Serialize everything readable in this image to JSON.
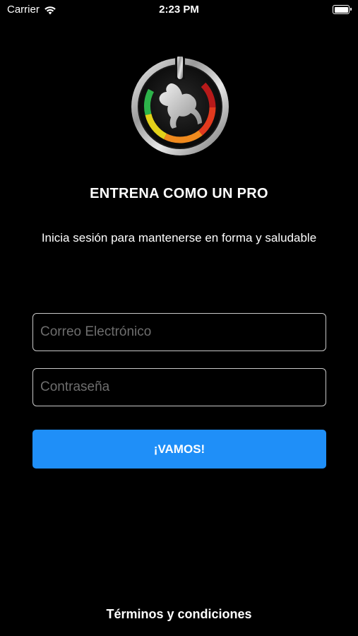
{
  "status_bar": {
    "carrier": "Carrier",
    "time": "2:23 PM",
    "icons": [
      "wifi-icon",
      "battery-icon"
    ]
  },
  "logo": {
    "icon": "power-button-bodybuilder-logo",
    "ring_colors": [
      "#2db34a",
      "#e4d21a",
      "#f08a1e",
      "#e23a1e",
      "#b81a1a"
    ]
  },
  "headline": "ENTRENA COMO UN PRO",
  "subtitle": "Inicia sesión para mantenerse en forma y saludable",
  "form": {
    "email_placeholder": "Correo Electrónico",
    "email_value": "",
    "password_placeholder": "Contraseña",
    "password_value": "",
    "submit_label": "¡VAMOS!"
  },
  "footer": {
    "terms_label": "Términos y condiciones"
  },
  "colors": {
    "background": "#000000",
    "accent": "#1f8ff8",
    "field_border": "#c8c8c8",
    "placeholder": "#6e6e6e"
  }
}
